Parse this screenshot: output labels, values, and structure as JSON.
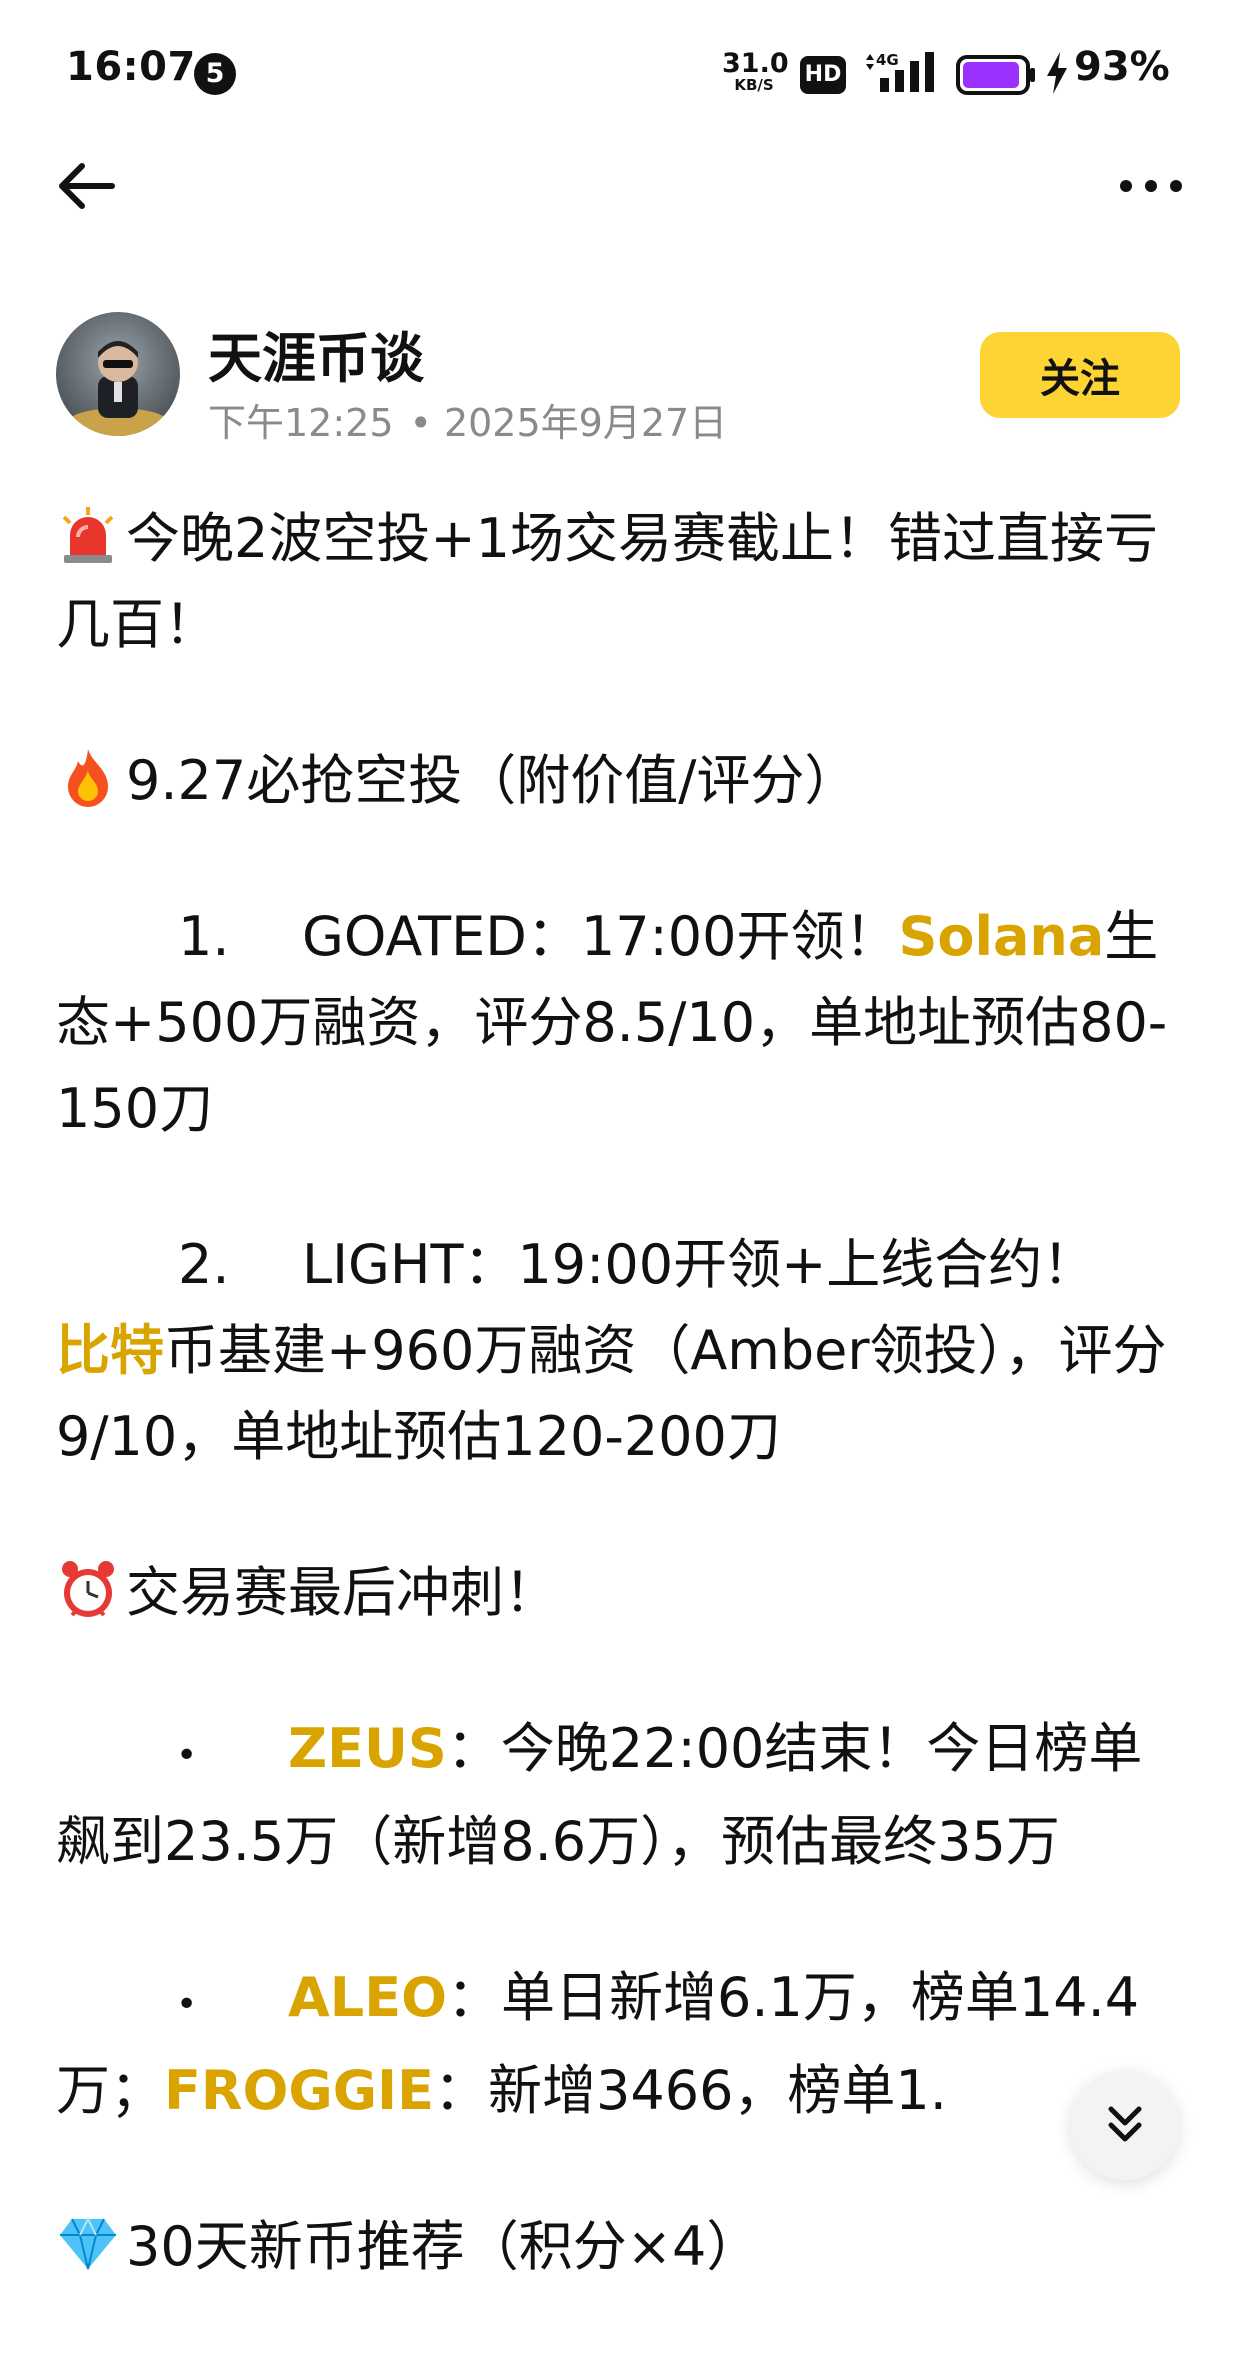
{
  "status_bar": {
    "time": "16:07",
    "notification_count": "5",
    "net_speed_value": "31.0",
    "net_speed_unit": "KB/S",
    "hd_label": "HD",
    "network_type": "4G",
    "battery_percent": "93%",
    "battery_level": 0.93,
    "battery_color": "#9b30ff"
  },
  "nav": {
    "back_icon": "arrow-left-icon",
    "more_icon": "more-horizontal-icon"
  },
  "author": {
    "name": "天涯币谈",
    "time": "下午12:25",
    "separator": "•",
    "date": "2025年9月27日",
    "follow_label": "关注",
    "follow_color": "#fcd535"
  },
  "post": {
    "headline": "今晚2波空投+1场交易赛截止！错过直接亏几百！",
    "airdrop_section_title": "9.27必抢空投（附价值/评分）",
    "item1": {
      "number": "1.",
      "lead": "GOATED：17:00开领！",
      "highlight": "Solana",
      "rest": "生态+500万融资，评分8.5/10，单地址预估80-150刀"
    },
    "item2": {
      "number": "2.",
      "lead": "LIGHT：19:00开领+上线合约！",
      "highlight": "比特",
      "rest": "币基建+960万融资（Amber领投），评分9/10，单地址预估120-200刀"
    },
    "trading_section_title": "交易赛最后冲刺！",
    "bullet1": {
      "marker": "•",
      "highlight": "ZEUS",
      "rest": "：今晚22:00结束！今日榜单飙到23.5万（新增8.6万），预估最终35万"
    },
    "bullet2": {
      "marker": "•",
      "highlight1": "ALEO",
      "text1": "：单日新增6.1万，榜单14.4万；",
      "highlight2": "FROGGIE",
      "text2": "：新增3466，榜单1."
    },
    "newcoin_section_title": "30天新币推荐（积分×4）",
    "highlight_color": "#d9a400"
  },
  "icons": {
    "siren": "siren-emoji-icon",
    "fire": "fire-emoji-icon",
    "alarm": "alarm-clock-emoji-icon",
    "gem": "gem-emoji-icon",
    "scroll_bottom": "double-chevron-down-icon"
  }
}
